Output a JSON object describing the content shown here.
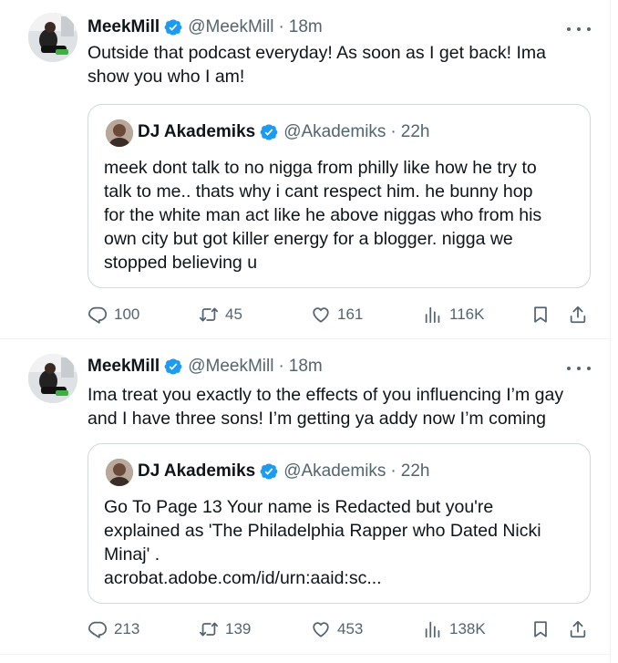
{
  "tweets": [
    {
      "author": {
        "name": "MeekMill",
        "handle": "@MeekMill",
        "time": "18m"
      },
      "text_lines": [
        "Outside that podcast everyday! As soon as I get back! Ima",
        "show you who I am!"
      ],
      "quote": {
        "author": {
          "name": "DJ Akademiks",
          "handle": "@Akademiks",
          "time": "22h"
        },
        "text_lines": [
          "meek dont talk to no nigga from philly like how he try to",
          "talk to me.. thats why i cant respect him. he bunny hop",
          "for the white man act like he above niggas who from his",
          "own city but got killer energy for a blogger. nigga we",
          "stopped believing u"
        ]
      },
      "stats": {
        "replies": "100",
        "reposts": "45",
        "likes": "161",
        "views": "116K"
      }
    },
    {
      "author": {
        "name": "MeekMill",
        "handle": "@MeekMill",
        "time": "18m"
      },
      "text_lines": [
        "Ima treat you exactly to the effects of you influencing  I’m gay",
        "and I have three sons! I’m getting ya addy now I’m coming"
      ],
      "quote": {
        "author": {
          "name": "DJ Akademiks",
          "handle": "@Akademiks",
          "time": "22h"
        },
        "text_lines": [
          "Go To Page 13 Your name is Redacted but you're",
          "explained  as 'The Philadelphia Rapper who Dated Nicki",
          "Minaj' .",
          "acrobat.adobe.com/id/urn:aaid:sc..."
        ]
      },
      "stats": {
        "replies": "213",
        "reposts": "139",
        "likes": "453",
        "views": "138K"
      }
    }
  ],
  "ui": {
    "separator": "·",
    "accent_color": "#1d9bf0",
    "muted_color": "#536471",
    "border_color": "#cfd9de"
  }
}
